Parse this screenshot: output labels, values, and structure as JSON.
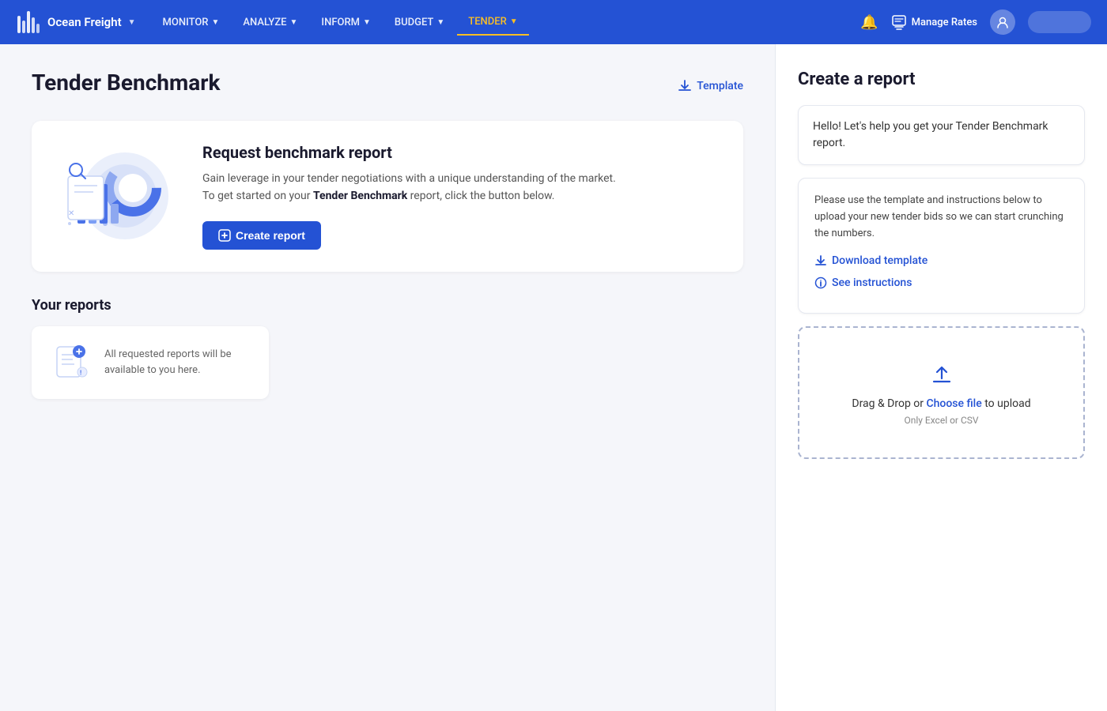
{
  "nav": {
    "logo_text": "Ocean Freight",
    "items": [
      {
        "label": "MONITOR",
        "active": false
      },
      {
        "label": "ANALYZE",
        "active": false
      },
      {
        "label": "INFORM",
        "active": false
      },
      {
        "label": "BUDGET",
        "active": false
      },
      {
        "label": "TENDER",
        "active": true
      }
    ],
    "manage_rates": "Manage Rates",
    "user_pill": ""
  },
  "left": {
    "page_title": "Tender Benchmark",
    "template_label": "Template",
    "benchmark_card": {
      "title": "Request benchmark report",
      "description_1": "Gain leverage in your tender negotiations with a unique understanding of the market.",
      "description_2": "To get started on your ",
      "description_bold": "Tender Benchmark",
      "description_3": " report, click the button below.",
      "create_button": "Create report"
    },
    "your_reports": {
      "title": "Your reports",
      "empty_text": "All requested reports will be available to you here."
    }
  },
  "right": {
    "title": "Create a report",
    "greeting": "Hello! Let's help you get your Tender Benchmark report.",
    "instructions_text": "Please use the template and instructions below to upload your new tender bids so we can start crunching the numbers.",
    "download_label": "Download template",
    "instructions_label": "See instructions",
    "upload_main": "Drag & Drop or ",
    "upload_link": "Choose file",
    "upload_main2": " to upload",
    "upload_hint": "Only Excel or CSV"
  }
}
